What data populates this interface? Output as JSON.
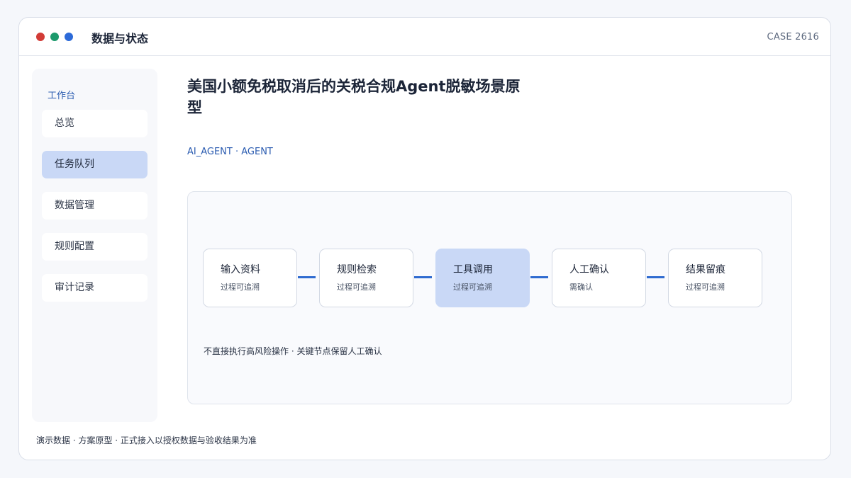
{
  "window": {
    "title": "数据与状态",
    "case_id": "CASE 2616"
  },
  "sidebar": {
    "heading": "工作台",
    "items": [
      {
        "label": "总览",
        "active": false
      },
      {
        "label": "任务队列",
        "active": true
      },
      {
        "label": "数据管理",
        "active": false
      },
      {
        "label": "规则配置",
        "active": false
      },
      {
        "label": "审计记录",
        "active": false
      }
    ]
  },
  "main": {
    "title": "美国小额免税取消后的关税合规Agent脱敏场景原型",
    "tags": "AI_AGENT · AGENT",
    "flow": {
      "steps": [
        {
          "name": "输入资料",
          "sub": "过程可追溯",
          "active": false
        },
        {
          "name": "规则检索",
          "sub": "过程可追溯",
          "active": false
        },
        {
          "name": "工具调用",
          "sub": "过程可追溯",
          "active": true
        },
        {
          "name": "人工确认",
          "sub": "需确认",
          "active": false
        },
        {
          "name": "结果留痕",
          "sub": "过程可追溯",
          "active": false
        }
      ],
      "note": "不直接执行高风险操作 · 关键节点保留人工确认"
    }
  },
  "footer": {
    "text": "演示数据 · 方案原型 · 正式接入以授权数据与验收结果为准"
  },
  "colors": {
    "accent": "#2f6bd0",
    "active_bg": "#c9d8f6",
    "dot_red": "#d23b36",
    "dot_green": "#1c9a6c",
    "dot_blue": "#2c6ad8"
  }
}
